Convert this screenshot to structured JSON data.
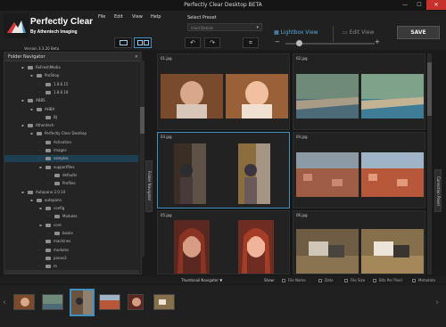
{
  "window": {
    "title": "Perfectly Clear Desktop BETA",
    "min": "—",
    "max": "☐",
    "close": "✕"
  },
  "brand": {
    "name": "Perfectly Clear",
    "by": "By Athentech Imaging",
    "version": "Version 3.3.20 Beta"
  },
  "menu": [
    "File",
    "Edit",
    "View",
    "Help"
  ],
  "preset": {
    "label": "Select Preset",
    "value": "Vivid Details"
  },
  "toolbar": {
    "undo": "↶",
    "redo": "↷",
    "crop": "⌗",
    "zoom_minus": "−",
    "zoom_plus": "+",
    "zoom_level": 0.15
  },
  "views": {
    "lightbox": "Lightbox View",
    "edit": "Edit View"
  },
  "save_label": "SAVE",
  "folder_nav": {
    "title": "Folder Navigator",
    "close": "✕",
    "items": [
      {
        "label": "ReFreshMedia",
        "depth": 0,
        "expanded": true
      },
      {
        "label": "ProShop",
        "depth": 1,
        "expanded": true
      },
      {
        "label": "1.8.6.15",
        "depth": 2,
        "expanded": false
      },
      {
        "label": "1.8.6.18",
        "depth": 2,
        "expanded": false
      },
      {
        "label": "ABBS",
        "depth": 0,
        "expanded": true
      },
      {
        "label": "AHBA",
        "depth": 1,
        "expanded": true
      },
      {
        "label": "BJ",
        "depth": 2,
        "expanded": false
      },
      {
        "label": "Athentech",
        "depth": 0,
        "expanded": true
      },
      {
        "label": "Perfectly Clear Desktop",
        "depth": 1,
        "expanded": true
      },
      {
        "label": "Activation",
        "depth": 2,
        "expanded": false
      },
      {
        "label": "images",
        "depth": 2,
        "expanded": false
      },
      {
        "label": "samples",
        "depth": 2,
        "expanded": false,
        "selected": true
      },
      {
        "label": "supportfiles",
        "depth": 2,
        "expanded": true
      },
      {
        "label": "defaults",
        "depth": 3,
        "expanded": false
      },
      {
        "label": "Profiles",
        "depth": 3,
        "expanded": false
      },
      {
        "label": "Autopano 2.0.10",
        "depth": 0,
        "expanded": true
      },
      {
        "label": "autopano",
        "depth": 1,
        "expanded": true
      },
      {
        "label": "config",
        "depth": 2,
        "expanded": true
      },
      {
        "label": "Modules",
        "depth": 3,
        "expanded": false
      },
      {
        "label": "core",
        "depth": 2,
        "expanded": true
      },
      {
        "label": "books",
        "depth": 3,
        "expanded": false
      },
      {
        "label": "machines",
        "depth": 2,
        "expanded": false
      },
      {
        "label": "modules",
        "depth": 2,
        "expanded": false
      },
      {
        "label": "panos3",
        "depth": 2,
        "expanded": false
      },
      {
        "label": "m",
        "depth": 2,
        "expanded": false
      }
    ]
  },
  "side_tabs": {
    "left": "Folder Navigator",
    "right": "Correction Panel"
  },
  "grid": [
    {
      "file": "01.jpg",
      "subject": "baby",
      "selected": false
    },
    {
      "file": "02.jpg",
      "subject": "coast",
      "selected": false
    },
    {
      "file": "03.jpg",
      "subject": "child-tree",
      "selected": true
    },
    {
      "file": "04.jpg",
      "subject": "town",
      "selected": false
    },
    {
      "file": "05.jpg",
      "subject": "woman",
      "selected": false
    },
    {
      "file": "06.jpg",
      "subject": "zebras",
      "selected": false
    }
  ],
  "thumb_nav": {
    "title": "Thumbnail Navigator ▼",
    "show": "Show:",
    "options": [
      "File Name",
      "Date",
      "File Size",
      "Bits Per Pixel",
      "Metadata"
    ],
    "prev": "‹",
    "next": "›"
  },
  "colors": {
    "accent": "#3d8fc4",
    "lightbox_text": "#5aa7de",
    "close_red": "#c7312b"
  }
}
